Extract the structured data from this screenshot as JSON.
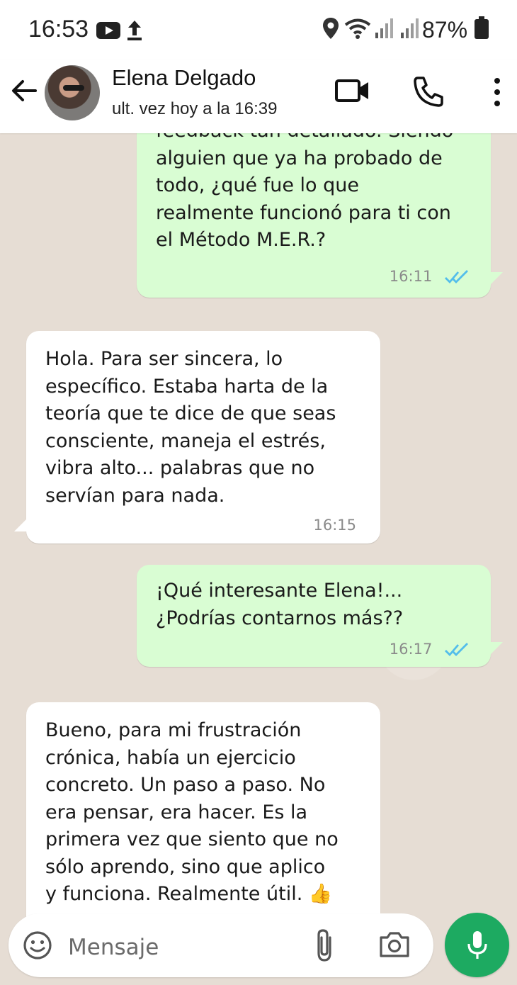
{
  "status_bar": {
    "time": "16:53",
    "battery": "87%",
    "icons": [
      "youtube-icon",
      "upload-icon",
      "location-icon",
      "wifi-icon",
      "signal-icon",
      "signal-icon",
      "battery-icon"
    ]
  },
  "header": {
    "contact_name": "Elena Delgado",
    "last_seen": "ult. vez hoy a la 16:39",
    "icons": [
      "back-arrow-icon",
      "video-call-icon",
      "phone-icon",
      "more-vert-icon"
    ]
  },
  "messages": [
    {
      "direction": "out",
      "text": "feedback tan detallado. Siendo\nalguien que ya ha probado de\ntodo, ¿qué fue lo que\nrealmente funcionó para ti con\nel Método M.E.R.?",
      "time": "16:11",
      "read": true
    },
    {
      "direction": "in",
      "text": "Hola. Para ser sincera, lo\nespecífico. Estaba harta de la\nteoría que te dice de que seas\nconsciente, maneja el estrés,\nvibra alto... palabras que no\nservían para nada.",
      "time": "16:15"
    },
    {
      "direction": "out",
      "text": "¡Qué interesante Elena!...\n¿Podrías contarnos más??",
      "time": "16:17",
      "read": true
    },
    {
      "direction": "in",
      "text": "Bueno, para mi frustración\ncrónica, había un ejercicio\nconcreto. Un paso a paso. No\nera pensar, era hacer. Es la\nprimera vez que siento que no\nsólo aprendo, sino que aplico\ny funciona. Realmente útil. 👍",
      "time": ""
    }
  ],
  "input": {
    "placeholder": "Mensaje"
  },
  "colors": {
    "outgoing_bubble": "#d9fdd3",
    "incoming_bubble": "#ffffff",
    "chat_background": "#e6ddd4",
    "mic_button": "#1daa61",
    "read_ticks": "#53bdeb"
  }
}
